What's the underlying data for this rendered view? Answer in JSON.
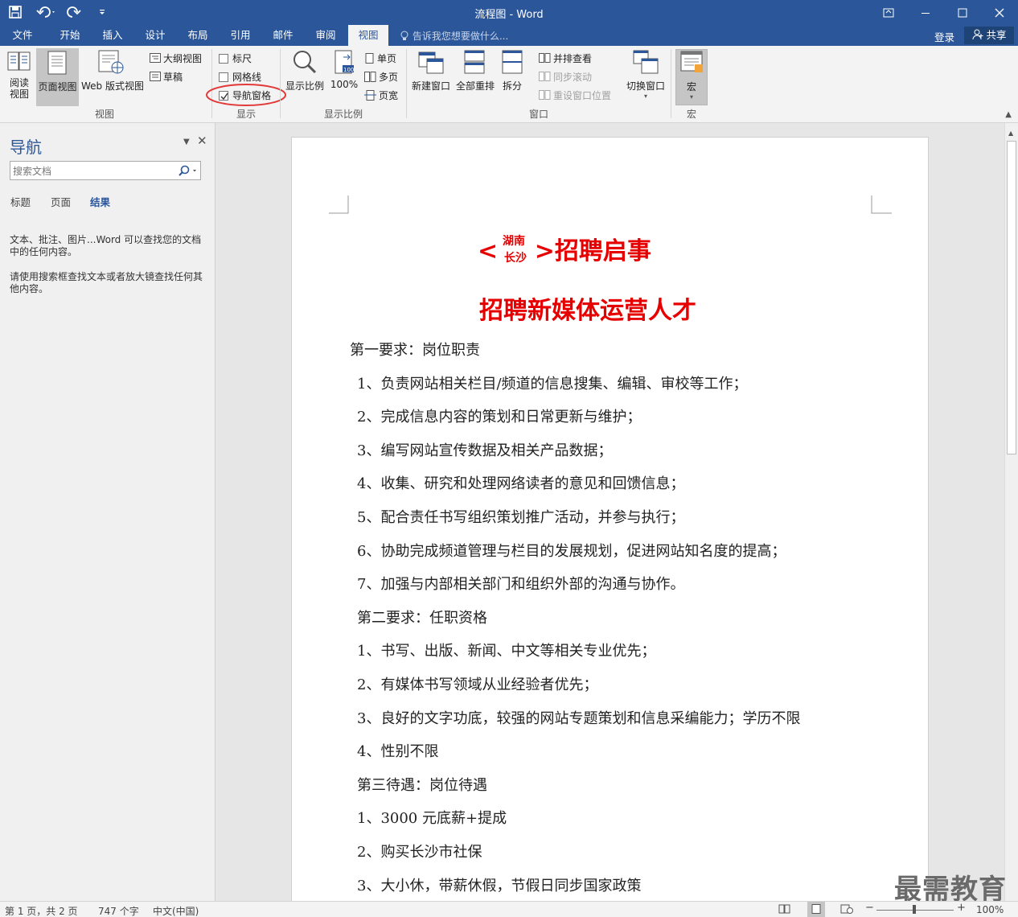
{
  "window": {
    "title": "流程图 - Word"
  },
  "tabs": [
    "文件",
    "开始",
    "插入",
    "设计",
    "布局",
    "引用",
    "邮件",
    "审阅",
    "视图"
  ],
  "active_tab": "视图",
  "tell_me": "告诉我您想要做什么...",
  "account": {
    "login": "登录",
    "share": "共享"
  },
  "ribbon": {
    "view": {
      "read": "阅读\n视图",
      "read1": "阅读",
      "read2": "视图",
      "print": "页面视图",
      "web": "Web 版式视图",
      "outline": "大纲视图",
      "draft": "草稿",
      "group": "视图"
    },
    "show": {
      "ruler": "标尺",
      "grid": "网格线",
      "navpane": "导航窗格",
      "navpane_checked": true,
      "group": "显示"
    },
    "zoom": {
      "zoom": "显示比例",
      "hundred": "100%",
      "one": "单页",
      "multi": "多页",
      "width": "页宽",
      "group": "显示比例"
    },
    "window": {
      "new": "新建窗口",
      "arrange": "全部重排",
      "split": "拆分",
      "side": "并排查看",
      "sync": "同步滚动",
      "reset": "重设窗口位置",
      "switch": "切换窗口",
      "group": "窗口"
    },
    "macro": {
      "macro": "宏",
      "group": "宏"
    }
  },
  "nav": {
    "title": "导航",
    "search_placeholder": "搜索文档",
    "tabs": [
      "标题",
      "页面",
      "结果"
    ],
    "msg1": "文本、批注、图片...Word 可以查找您的文档中的任何内容。",
    "msg2": "请使用搜索框查找文本或者放大镜查找任何其他内容。"
  },
  "document": {
    "title_prefix": "<",
    "title_top": "湖南",
    "title_bottom": "长沙",
    "title_suffix": ">招聘启事",
    "subtitle": "招聘新媒体运营人才",
    "lines": [
      "第一要求：岗位职责",
      "1、负责网站相关栏目/频道的信息搜集、编辑、审校等工作；",
      "2、完成信息内容的策划和日常更新与维护；",
      "3、编写网站宣传数据及相关产品数据；",
      "4、收集、研究和处理网络读者的意见和回馈信息；",
      "5、配合责任书写组织策划推广活动，并参与执行；",
      "6、协助完成频道管理与栏目的发展规划，促进网站知名度的提高；",
      "7、加强与内部相关部门和组织外部的沟通与协作。",
      "第二要求：任职资格",
      "1、书写、出版、新闻、中文等相关专业优先；",
      "2、有媒体书写领域从业经验者优先；",
      "3、良好的文字功底，较强的网站专题策划和信息采编能力；学历不限",
      "4、性别不限",
      "第三待遇：岗位待遇",
      "1、3000 元底薪+提成",
      "2、购买长沙市社保",
      "3、大小休，带薪休假，节假日同步国家政策"
    ]
  },
  "status": {
    "page": "第 1 页，共 2 页",
    "words": "747 个字",
    "lang": "中文(中国)",
    "zoom": "100%"
  },
  "watermark": "最需教育",
  "colors": {
    "accent": "#2b579a",
    "title_red": "#e60000",
    "highlight_circle": "#e23a3a"
  }
}
